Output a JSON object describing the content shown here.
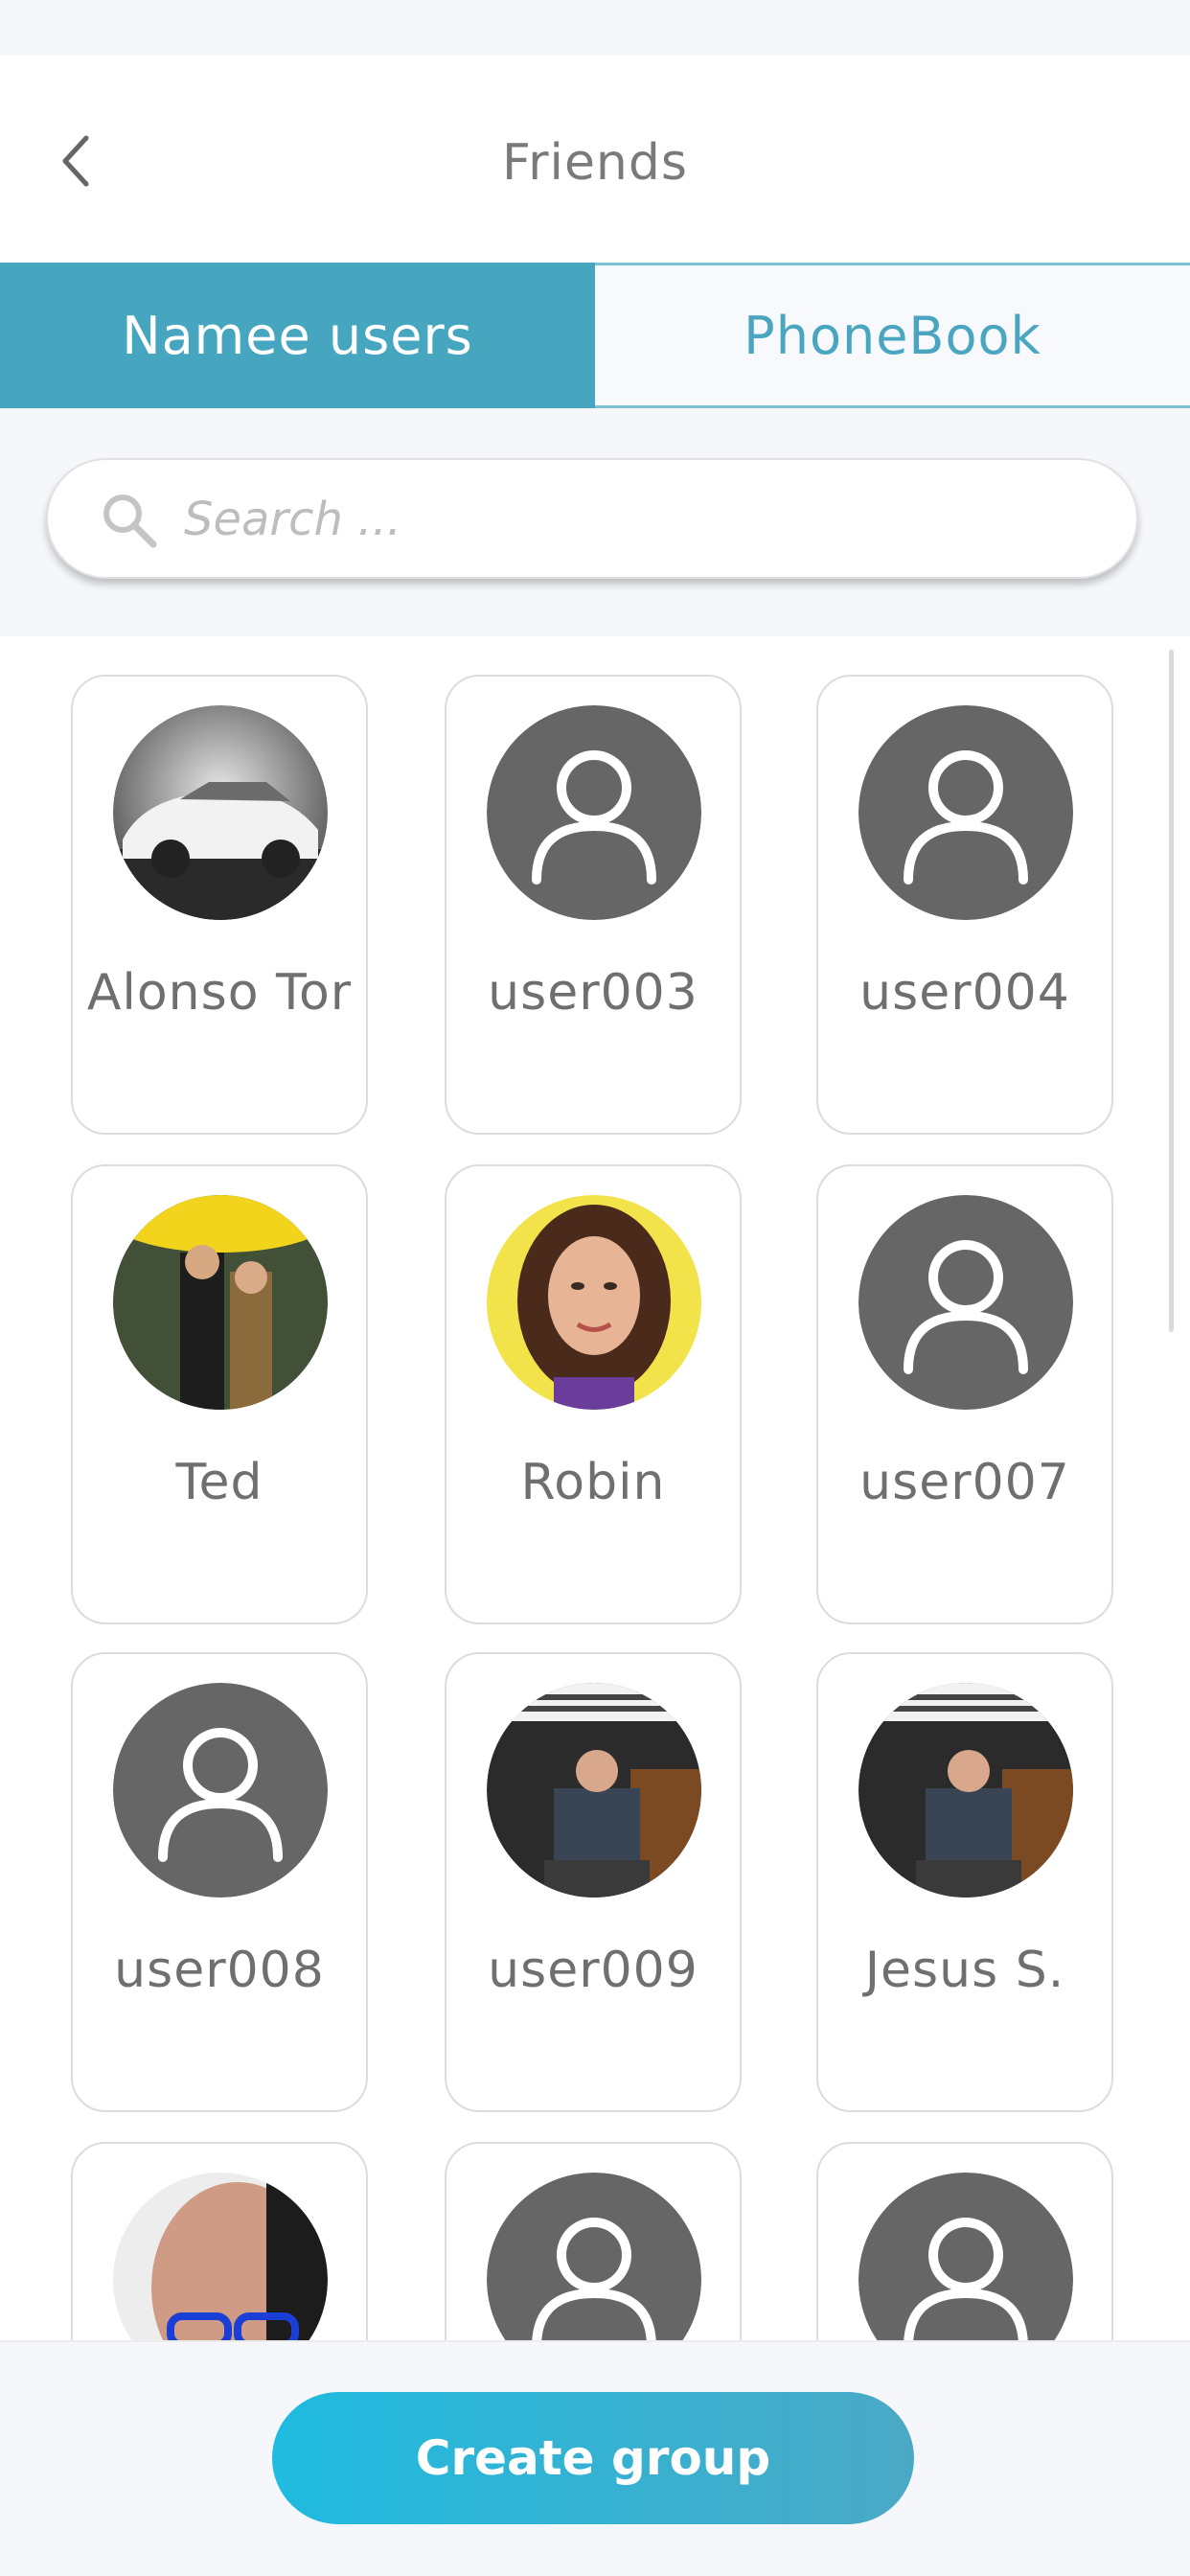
{
  "header": {
    "title": "Friends"
  },
  "tabs": [
    {
      "label": "Namee users",
      "active": true
    },
    {
      "label": "PhoneBook",
      "active": false
    }
  ],
  "search": {
    "placeholder": "Search ...",
    "value": ""
  },
  "colors": {
    "accent": "#46a6bf",
    "button_start": "#1fbbe0",
    "button_end": "#4aa9c5",
    "avatar_default": "#666666"
  },
  "friends": [
    {
      "name": "Alonso Tor",
      "avatar": "photo-white-car"
    },
    {
      "name": "user003",
      "avatar": "default-user-icon"
    },
    {
      "name": "user004",
      "avatar": "default-user-icon"
    },
    {
      "name": "Ted",
      "avatar": "photo-couple-yellow-umbrella"
    },
    {
      "name": "Robin",
      "avatar": "photo-woman-portrait"
    },
    {
      "name": "user007",
      "avatar": "default-user-icon"
    },
    {
      "name": "user008",
      "avatar": "default-user-icon"
    },
    {
      "name": "user009",
      "avatar": "photo-seated-man"
    },
    {
      "name": "Jesus S.",
      "avatar": "photo-seated-man"
    },
    {
      "name": "",
      "avatar": "photo-man-blue-glasses"
    },
    {
      "name": "",
      "avatar": "default-user-icon"
    },
    {
      "name": "",
      "avatar": "default-user-icon"
    }
  ],
  "footer": {
    "create_group_label": "Create group"
  }
}
